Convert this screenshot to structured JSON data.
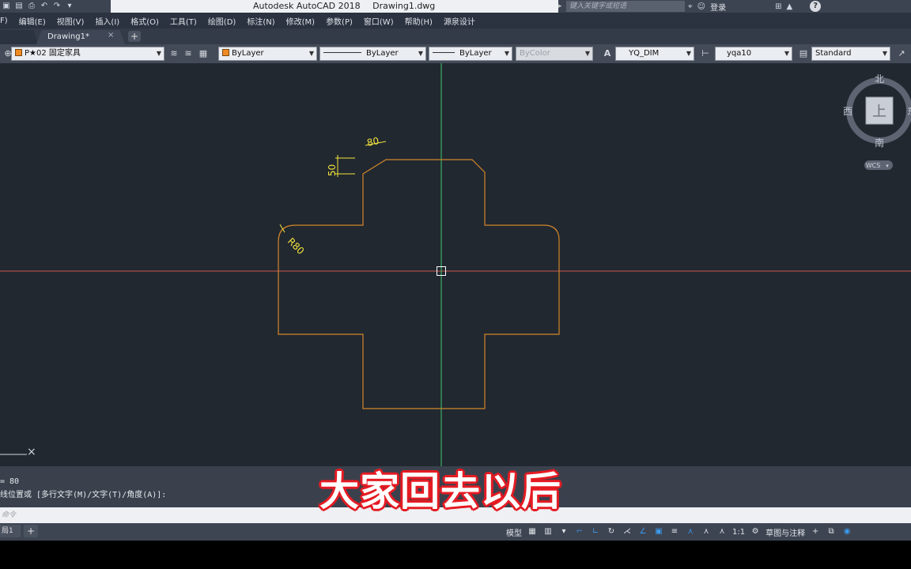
{
  "window": {
    "app_title": "Autodesk AutoCAD 2018",
    "file_title": "Drawing1.dwg",
    "search_placeholder": "键入关键字或短语",
    "login_label": "登录",
    "help_label": "?"
  },
  "menu": [
    "F)",
    "编辑(E)",
    "视图(V)",
    "插入(I)",
    "格式(O)",
    "工具(T)",
    "绘图(D)",
    "标注(N)",
    "修改(M)",
    "参数(P)",
    "窗口(W)",
    "帮助(H)",
    "源泉设计"
  ],
  "tabs": {
    "active_label": "Drawing1*",
    "close_glyph": "×",
    "add_glyph": "+"
  },
  "properties": {
    "layer": "P★02 固定家具",
    "color": "ByLayer",
    "linetype": "ByLayer",
    "lineweight": "ByLayer",
    "plotstyle": "ByColor",
    "text_style": "YQ_DIM",
    "dim_style": "yqa10",
    "table_style": "Standard"
  },
  "viewcube": {
    "north": "北",
    "south": "南",
    "west": "西",
    "east": "东",
    "top": "上",
    "wcs": "WCS"
  },
  "drawing": {
    "dim_top": "80",
    "dim_side": "50",
    "dim_radius": "R80",
    "colors": {
      "background": "#212830",
      "shape": "#d4862a",
      "dimension": "#f2e23c",
      "x_axis": "#c9574c",
      "y_axis": "#3fc76b"
    }
  },
  "command": {
    "line1": "= 80",
    "line2": "线位置或 [多行文字(M)/文字(T)/角度(A)]:",
    "input_placeholder": "命令"
  },
  "status": {
    "layout_tab": "局1",
    "add_glyph": "+",
    "model_label": "模型",
    "scale_label": "1:1",
    "workspace_label": "草图与注释"
  },
  "subtitle": "大家回去以后"
}
